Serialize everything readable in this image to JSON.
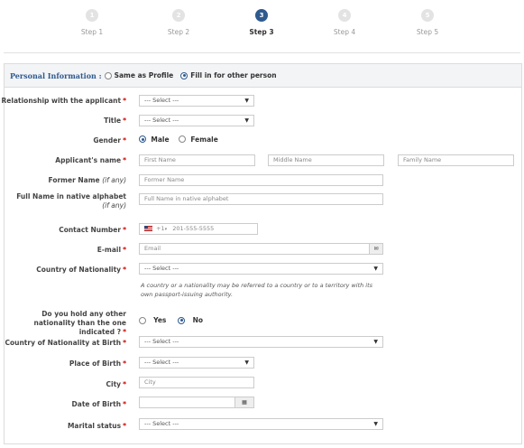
{
  "steps": [
    {
      "num": "1",
      "label": "Step 1"
    },
    {
      "num": "2",
      "label": "Step 2"
    },
    {
      "num": "3",
      "label": "Step 3"
    },
    {
      "num": "4",
      "label": "Step 4"
    },
    {
      "num": "5",
      "label": "Step 5"
    }
  ],
  "active_step": 3,
  "section": {
    "title": "Personal Information :",
    "option_same": "Same as Profile",
    "option_fill": "Fill in for other person"
  },
  "form": {
    "relationship": {
      "label": "Relationship with the applicant",
      "value": "--- Select ---"
    },
    "title": {
      "label": "Title",
      "value": "--- Select ---"
    },
    "gender": {
      "label": "Gender",
      "male": "Male",
      "female": "Female"
    },
    "name": {
      "label": "Applicant's name",
      "first": "First Name",
      "middle": "Middle Name",
      "family": "Family Name"
    },
    "former": {
      "label": "Former Name",
      "label_note": "(if any)",
      "placeholder": "Former Name"
    },
    "native": {
      "label": "Full Name in native alphabet",
      "label_note": "(if any)",
      "placeholder": "Full Name in native alphabet"
    },
    "contact": {
      "label": "Contact Number",
      "code": "+1",
      "placeholder": "201-555-5555"
    },
    "email": {
      "label": "E-mail",
      "placeholder": "Email"
    },
    "nationality": {
      "label": "Country of Nationality",
      "value": "--- Select ---",
      "hint": "A country or a nationality may be referred to a country or to a territory with its own passport-issuing authority."
    },
    "other_nat": {
      "label": "Do you hold any other nationality than the one indicated ?",
      "yes": "Yes",
      "no": "No"
    },
    "nat_birth": {
      "label": "Country of Nationality at Birth",
      "value": "--- Select ---"
    },
    "place_birth": {
      "label": "Place of Birth",
      "value": "--- Select ---"
    },
    "city": {
      "label": "City",
      "placeholder": "City"
    },
    "dob": {
      "label": "Date of Birth"
    },
    "marital": {
      "label": "Marital status",
      "value": "--- Select ---"
    }
  }
}
